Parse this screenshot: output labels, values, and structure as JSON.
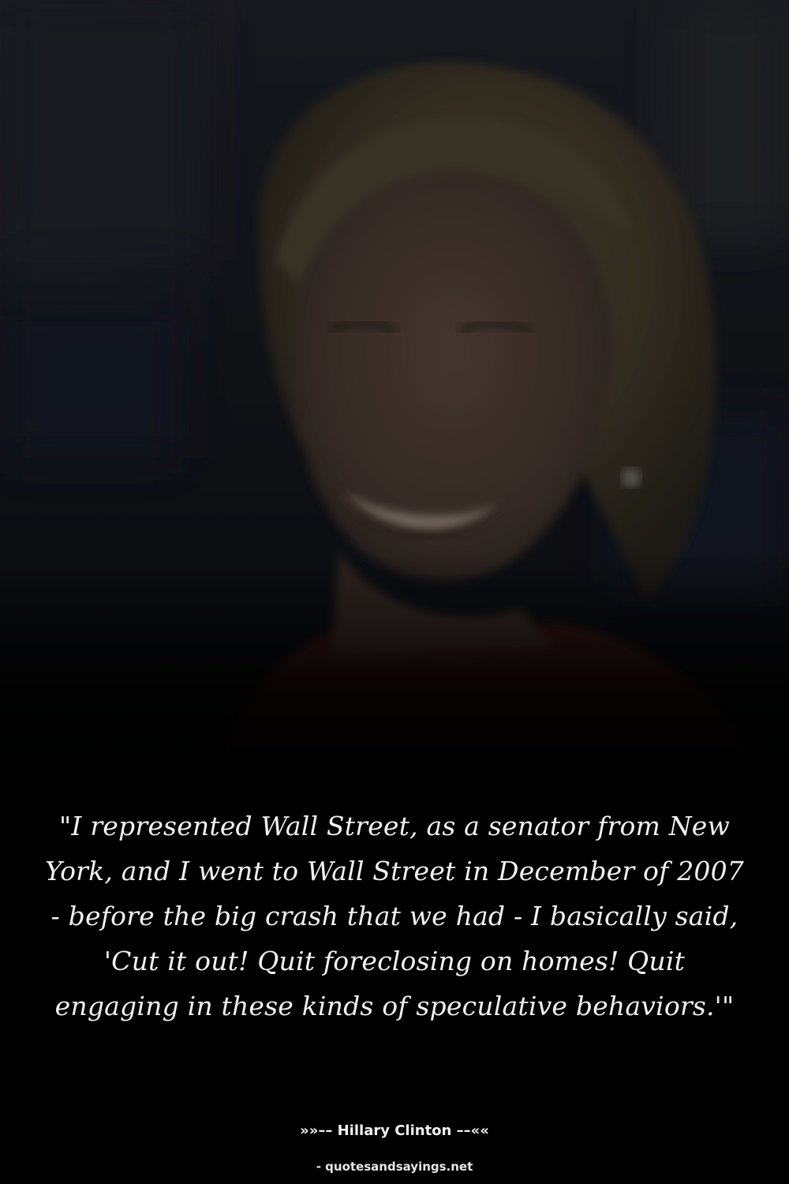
{
  "photo": {
    "subject": "smiling woman with short blonde hair wearing a red top, darkened background photo"
  },
  "quote": {
    "text": "\"I represented Wall Street, as a senator from New York, and I went to Wall Street in December of 2007 - before the big crash that we had - I basically said, 'Cut it out! Quit foreclosing on homes! Quit engaging in these kinds of speculative behaviors.'\""
  },
  "attribution": {
    "text": "»»–– Hillary Clinton ––««"
  },
  "source": {
    "text": "- quotesandsayings.net"
  },
  "colors": {
    "background": "#000000",
    "text": "#f1f1f1"
  }
}
